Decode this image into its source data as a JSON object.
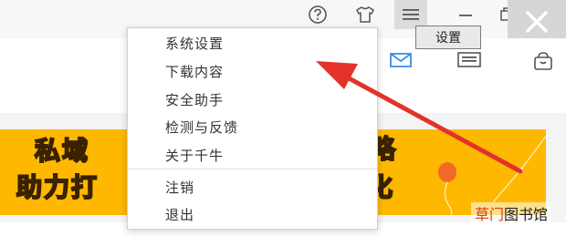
{
  "titlebar": {
    "help_icon": "question-circle",
    "skin_icon": "tshirt",
    "menu_icon": "hamburger",
    "minimize_icon": "minus",
    "maximize_icon": "restore",
    "close_icon": "x"
  },
  "tooltip": {
    "text": "设置"
  },
  "toolbar_icons": [
    "mail-icon",
    "card-icon",
    "bag-icon"
  ],
  "menu": {
    "items": [
      {
        "label": "系统设置"
      },
      {
        "label": "下载内容"
      },
      {
        "label": "安全助手"
      },
      {
        "label": "检测与反馈"
      },
      {
        "label": "关于千牛"
      },
      {
        "label": "注销"
      },
      {
        "label": "退出"
      }
    ]
  },
  "banner": {
    "line1_left": "私域",
    "line2_left": "助力打",
    "line1_right": "略",
    "line2_right": "化",
    "bg_color": "#ffb800"
  },
  "watermark": {
    "highlight": "草门",
    "rest": "图书馆"
  },
  "colors": {
    "arrow": "#e3322a",
    "accent_blue": "#3a8ee6"
  }
}
